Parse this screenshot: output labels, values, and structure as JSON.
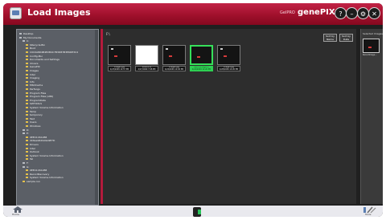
{
  "window": {
    "title": "Load Images",
    "brand_small": "GelPRO",
    "brand": "genePIX"
  },
  "titlebar_buttons": [
    {
      "name": "help-button",
      "glyph": "?"
    },
    {
      "name": "minimize-button",
      "glyph": "–"
    },
    {
      "name": "settings-button",
      "glyph": "⚙"
    },
    {
      "name": "close-button",
      "glyph": "✕"
    }
  ],
  "tree": [
    {
      "label": "Desktop",
      "indent": 0,
      "color": "gray"
    },
    {
      "label": "My Documents",
      "indent": 0,
      "color": "gray"
    },
    {
      "label": "C:",
      "indent": 1,
      "color": "gray"
    },
    {
      "label": "$Recycle.Bin",
      "indent": 2,
      "color": "yellow"
    },
    {
      "label": "Boot",
      "indent": 2,
      "color": "yellow"
    },
    {
      "label": "C0C0A8D4B4E2B4C7B3DB7B3E6DE3C4",
      "indent": 2,
      "color": "yellow"
    },
    {
      "label": "Config.Msi",
      "indent": 2,
      "color": "yellow"
    },
    {
      "label": "Documents and Settings",
      "indent": 2,
      "color": "yellow"
    },
    {
      "label": "drivers",
      "indent": 2,
      "color": "yellow"
    },
    {
      "label": "GenePIX",
      "indent": 2,
      "color": "yellow"
    },
    {
      "label": "Images",
      "indent": 2,
      "color": "yellow"
    },
    {
      "label": "Intel",
      "indent": 2,
      "color": "yellow"
    },
    {
      "label": "Imaging",
      "indent": 2,
      "color": "yellow"
    },
    {
      "label": "Info",
      "indent": 2,
      "color": "yellow"
    },
    {
      "label": "MSOCache",
      "indent": 2,
      "color": "yellow"
    },
    {
      "label": "PerfLogs",
      "indent": 2,
      "color": "yellow"
    },
    {
      "label": "Program Files",
      "indent": 2,
      "color": "yellow"
    },
    {
      "label": "Program Files (x86)",
      "indent": 2,
      "color": "yellow"
    },
    {
      "label": "ProgramData",
      "indent": 2,
      "color": "yellow"
    },
    {
      "label": "SWTOOLS",
      "indent": 2,
      "color": "yellow"
    },
    {
      "label": "System Volume Information",
      "indent": 2,
      "color": "yellow"
    },
    {
      "label": "Temp",
      "indent": 2,
      "color": "yellow"
    },
    {
      "label": "temporary",
      "indent": 2,
      "color": "yellow"
    },
    {
      "label": "Test",
      "indent": 2,
      "color": "yellow"
    },
    {
      "label": "Users",
      "indent": 2,
      "color": "yellow"
    },
    {
      "label": "Windows",
      "indent": 2,
      "color": "yellow"
    },
    {
      "label": "D:",
      "indent": 1,
      "color": "gray"
    },
    {
      "label": "E:",
      "indent": 1,
      "color": "gray"
    },
    {
      "label": "0EEC1C61288",
      "indent": 2,
      "color": "yellow"
    },
    {
      "label": "4C6ee9420A9A9E7D",
      "indent": 2,
      "color": "yellow"
    },
    {
      "label": "Drivers",
      "indent": 2,
      "color": "yellow"
    },
    {
      "label": "Intel",
      "indent": 2,
      "color": "yellow"
    },
    {
      "label": "Outlook",
      "indent": 2,
      "color": "yellow"
    },
    {
      "label": "System Volume Information",
      "indent": 2,
      "color": "yellow"
    },
    {
      "label": "Tel",
      "indent": 2,
      "color": "yellow"
    },
    {
      "label": "F:",
      "indent": 1,
      "color": "gray"
    },
    {
      "label": "G:",
      "indent": 1,
      "color": "gray"
    },
    {
      "label": "0EEC1C61288",
      "indent": 2,
      "color": "yellow"
    },
    {
      "label": "RecordRecovery",
      "indent": 2,
      "color": "yellow"
    },
    {
      "label": "System Volume Information",
      "indent": 2,
      "color": "yellow"
    },
    {
      "label": "sample.run",
      "indent": 1,
      "color": "yellow"
    }
  ],
  "center": {
    "path": "F:\\",
    "sort_buttons": [
      {
        "line1": "Sort by",
        "line2": "Name"
      },
      {
        "line1": "Sort by",
        "line2": "Date"
      }
    ],
    "thumbnails": [
      {
        "line1": "image1.jpg",
        "line2": "4/23/2009 12:57 PM",
        "style": "dark",
        "selected": false
      },
      {
        "line1": "scan01.tif",
        "line2": "4/27/2009 7:08 PM",
        "style": "white",
        "selected": false
      },
      {
        "line1": "image2.jpg",
        "line2": "4/24/2009 12:04 PM",
        "style": "dark",
        "selected": false
      },
      {
        "line1": "RecordImage.tif",
        "line2": "4/24/2009 12:26 PM",
        "style": "dark",
        "selected": true
      },
      {
        "line1": "image3.jpg",
        "line2": "4/28/2009 12:26 PM",
        "style": "dark",
        "selected": false
      }
    ]
  },
  "right_panel": {
    "title": "Selected Images",
    "thumb_caption": "RecordImage..."
  },
  "bottom": {
    "home_label": "Home",
    "tools_label": "Tools"
  }
}
